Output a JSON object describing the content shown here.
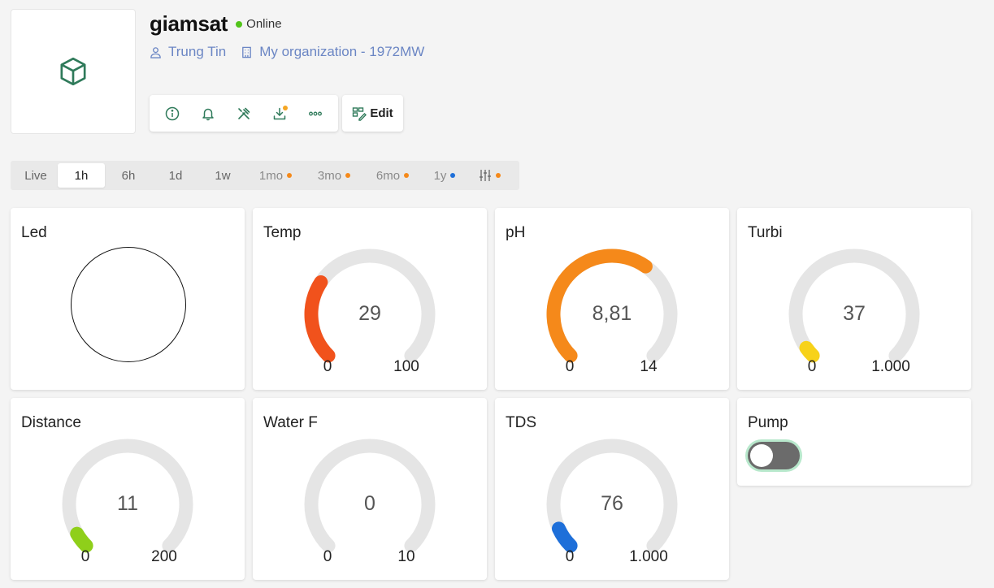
{
  "device": {
    "name": "giamsat",
    "status": "Online",
    "owner": "Trung Tin",
    "organization": "My organization - 1972MW",
    "icon": "cube-icon"
  },
  "toolbar": {
    "buttons": [
      "info-icon",
      "bell-icon",
      "tools-icon",
      "download-icon",
      "more-icon"
    ],
    "edit_label": "Edit"
  },
  "time_ranges": {
    "options": [
      {
        "label": "Live",
        "active": false
      },
      {
        "label": "1h",
        "active": true
      },
      {
        "label": "6h",
        "active": false
      },
      {
        "label": "1d",
        "active": false
      },
      {
        "label": "1w",
        "active": false
      },
      {
        "label": "1mo",
        "dot": "#f5891a"
      },
      {
        "label": "3mo",
        "dot": "#f5891a"
      },
      {
        "label": "6mo",
        "dot": "#f5891a"
      },
      {
        "label": "1y",
        "dot": "#1e6fd9"
      },
      {
        "label": "",
        "icon": "sliders-icon",
        "dot": "#f5891a"
      }
    ]
  },
  "widgets": {
    "led": {
      "title": "Led"
    },
    "temp": {
      "title": "Temp",
      "value": "29",
      "min": "0",
      "max": "100",
      "fraction": 0.29,
      "color": "#f1521c"
    },
    "ph": {
      "title": "pH",
      "value": "8,81",
      "min": "0",
      "max": "14",
      "fraction": 0.63,
      "color": "#f5891a"
    },
    "turbi": {
      "title": "Turbi",
      "value": "37",
      "min": "0",
      "max": "1.000",
      "fraction": 0.037,
      "color": "#f7d21a"
    },
    "distance": {
      "title": "Distance",
      "value": "11",
      "min": "0",
      "max": "200",
      "fraction": 0.055,
      "color": "#8fcf1a"
    },
    "waterf": {
      "title": "Water F",
      "value": "0",
      "min": "0",
      "max": "10",
      "fraction": 0,
      "color": "#cccccc"
    },
    "tds": {
      "title": "TDS",
      "value": "76",
      "min": "0",
      "max": "1.000",
      "fraction": 0.076,
      "color": "#1e6fd9"
    },
    "pump": {
      "title": "Pump",
      "state": "off"
    }
  }
}
